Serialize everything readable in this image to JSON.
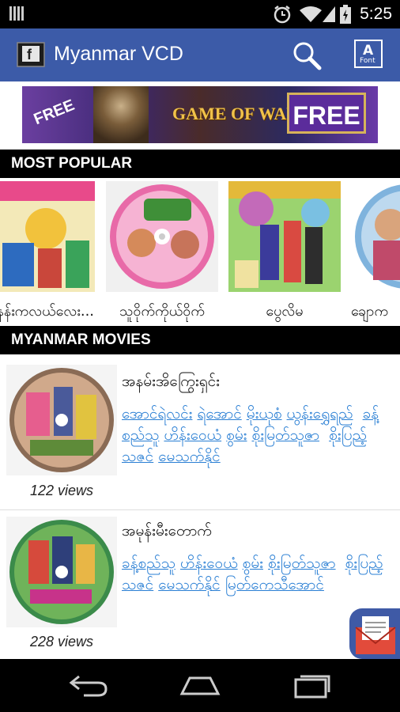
{
  "status_bar": {
    "time": "5:25",
    "icons": [
      "notification-bars-icon",
      "alarm-icon",
      "wifi-icon",
      "signal-icon",
      "battery-icon"
    ]
  },
  "app_bar": {
    "title": "Myanmar VCD",
    "font_button_label": "Font",
    "font_button_letter": "A",
    "bg_color": "#3c5ba8"
  },
  "banner": {
    "left_text": "FREE",
    "center_text": "GAME OF WAR",
    "right_text": "FREE"
  },
  "sections": {
    "popular": "MOST POPULAR",
    "movies": "MYANMAR MOVIES"
  },
  "popular": [
    {
      "title": "အနန်းကလယ်လေး..."
    },
    {
      "title": "သူဝိုက်ကိုယ်ဝိုက်"
    },
    {
      "title": "ပွေလိမ"
    },
    {
      "title": "ချောက"
    }
  ],
  "movies": [
    {
      "title": "အနမ်းအိကြွေးရှင်း",
      "cast": [
        "အောင်ရဲလင်း",
        "ရဲအောင်",
        "မိုးယုစံ",
        "ယွန်းရွှေရည်",
        "ခန့်စည်သူ",
        "ဟိန်းဝေယံ",
        "စွမ်း",
        "စိုးမြတ်သူဇာ",
        "စိုးပြည့်သဇင်",
        "မေသက်နိုင်"
      ],
      "views": "122 views"
    },
    {
      "title": "အမုန်းမီးတောက်",
      "cast": [
        "ခန့်စည်သူ",
        "ဟိန်းဝေယံ",
        "စွမ်း",
        "စိုးမြတ်သူဇာ",
        "စိုးပြည့်သဇင်",
        "မေသက်နိုင်",
        "မြတ်ကေသီအောင်"
      ],
      "views": "228 views"
    }
  ]
}
